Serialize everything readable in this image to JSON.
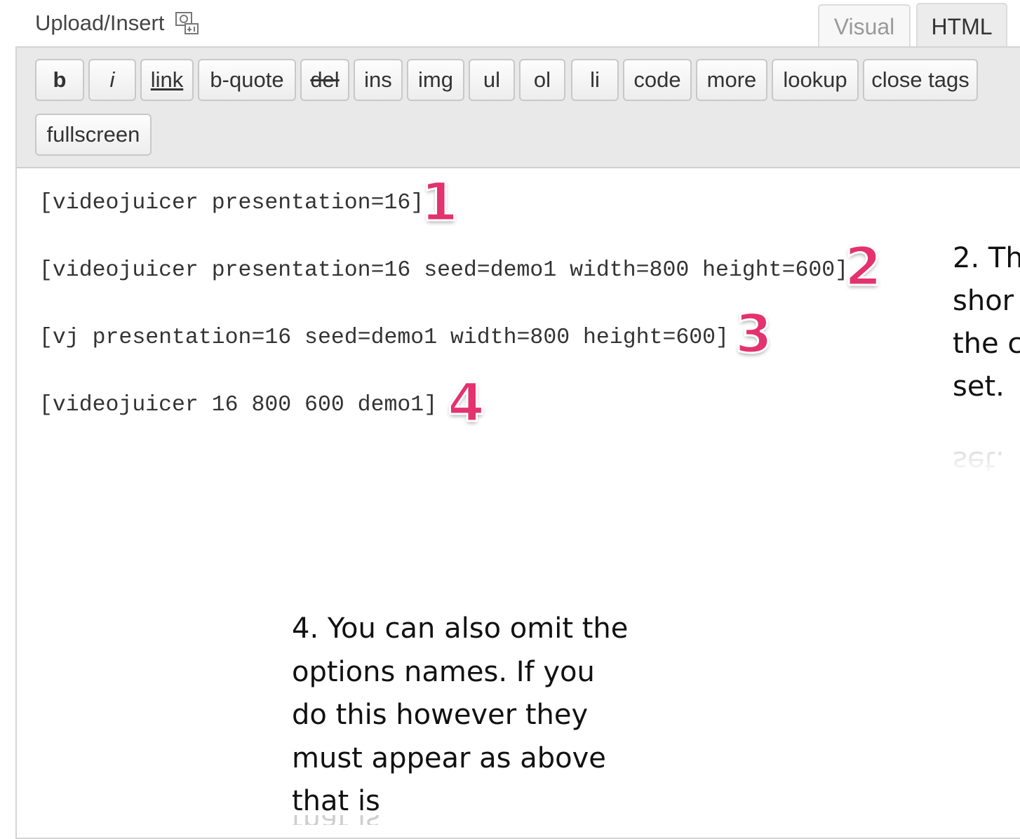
{
  "header": {
    "upload_label": "Upload/Insert",
    "upload_icon": "media-upload-icon",
    "tabs": [
      {
        "label": "Visual",
        "active": false
      },
      {
        "label": "HTML",
        "active": true
      }
    ]
  },
  "toolbar": {
    "buttons": [
      "b",
      "i",
      "link",
      "b-quote",
      "del",
      "ins",
      "img",
      "ul",
      "ol",
      "li",
      "code",
      "more",
      "lookup",
      "close tags",
      "fullscreen"
    ]
  },
  "editor": {
    "lines": [
      "[videojuicer presentation=16]",
      "[videojuicer presentation=16 seed=demo1 width=800 height=600]",
      "[vj presentation=16 seed=demo1 width=800 height=600]",
      "[videojuicer 16 800 600 demo1]"
    ],
    "markers": [
      "1",
      "2",
      "3",
      "4"
    ]
  },
  "annotations": {
    "side_note_lines": [
      "2. Th",
      "shor",
      "the c",
      "set."
    ],
    "bottom_note_lines": [
      "4. You can also omit the",
      "options names. If you",
      "do this however they",
      "must appear as above",
      "that is"
    ]
  },
  "colors": {
    "marker": "#e3326e",
    "toolbar_bg": "#e9e9e9",
    "active_tab_bg": "#ececec"
  }
}
